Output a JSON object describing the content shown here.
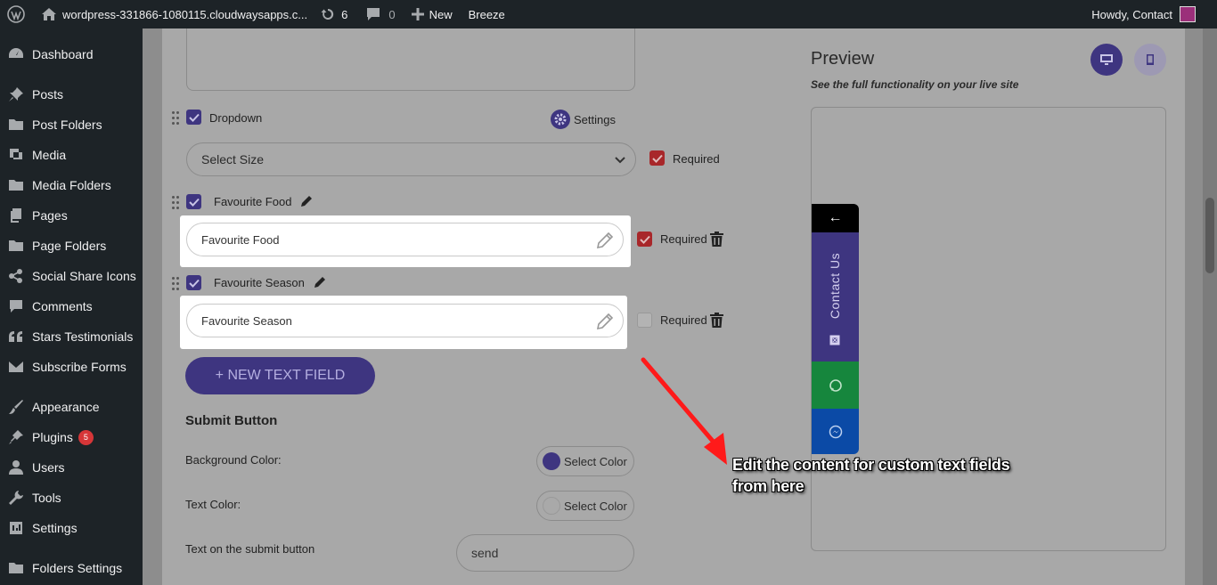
{
  "admin_bar": {
    "site_name": "wordpress-331866-1080115.cloudwaysapps.c...",
    "updates_count": "6",
    "comments_count": "0",
    "new_label": "New",
    "breeze_label": "Breeze",
    "howdy": "Howdy, Contact"
  },
  "sidebar": {
    "items": [
      {
        "label": "Dashboard",
        "icon": "dashboard-icon"
      },
      {
        "label": "Posts",
        "icon": "pin-icon"
      },
      {
        "label": "Post Folders",
        "icon": "folder-icon"
      },
      {
        "label": "Media",
        "icon": "media-icon"
      },
      {
        "label": "Media Folders",
        "icon": "folder-icon"
      },
      {
        "label": "Pages",
        "icon": "pages-icon"
      },
      {
        "label": "Page Folders",
        "icon": "folder-icon"
      },
      {
        "label": "Social Share Icons",
        "icon": "share-icon"
      },
      {
        "label": "Comments",
        "icon": "comment-icon"
      },
      {
        "label": "Stars Testimonials",
        "icon": "quote-icon"
      },
      {
        "label": "Subscribe Forms",
        "icon": "mail-icon"
      },
      {
        "label": "Appearance",
        "icon": "brush-icon"
      },
      {
        "label": "Plugins",
        "icon": "plugin-icon",
        "badge": "5"
      },
      {
        "label": "Users",
        "icon": "user-icon"
      },
      {
        "label": "Tools",
        "icon": "wrench-icon"
      },
      {
        "label": "Settings",
        "icon": "settings-icon"
      },
      {
        "label": "Folders Settings",
        "icon": "folder-icon"
      }
    ]
  },
  "form": {
    "dropdown_label": "Dropdown",
    "settings_label": "Settings",
    "select_placeholder": "Select Size",
    "required_label": "Required",
    "field1_label": "Favourite Food",
    "field1_value": "Favourite Food",
    "field2_label": "Favourite Season",
    "field2_value": "Favourite Season",
    "new_text_field": "+ NEW TEXT FIELD",
    "submit_section": "Submit Button",
    "bg_color_label": "Background Color:",
    "text_color_label": "Text Color:",
    "select_color": "Select Color",
    "submit_text_label": "Text on the submit button",
    "submit_text_value": "send",
    "bg_color_swatch": "#3e3580",
    "text_color_swatch": "#a9a9a9"
  },
  "preview": {
    "title": "Preview",
    "subtitle": "See the full functionality on your live site",
    "widget_arrow": "←",
    "widget_label": "Contact Us",
    "colors": {
      "accent": "#3e3580",
      "whatsapp": "#16863d",
      "messenger": "#0b4aa6",
      "dark": "#000000"
    }
  },
  "annotation": {
    "line1": "Edit the content for custom text fields",
    "line2": "from here"
  }
}
